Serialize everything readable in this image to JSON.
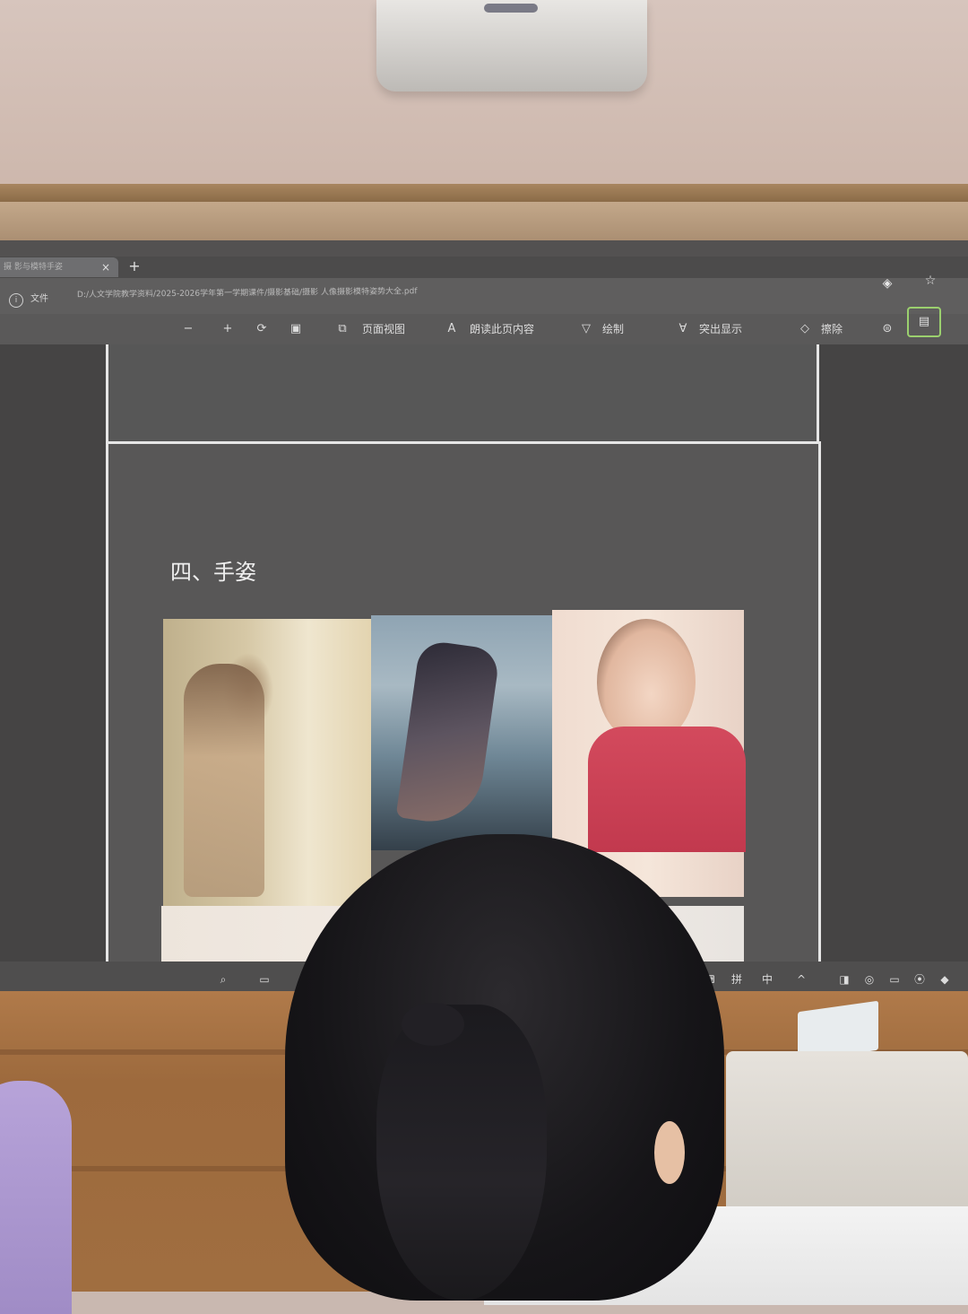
{
  "browser": {
    "tab_label": "摄 影与模特手姿",
    "tab_close": "×",
    "tab_new": "+",
    "file_label": "文件",
    "url": "D:/人文学院教学资料/2025-2026学年第一学期课件/摄影基础/摄影 人像摄影模特姿势大全.pdf"
  },
  "pdf_toolbar": {
    "zoom_out": "−",
    "zoom_in": "+",
    "page_view": "页面视图",
    "read_aloud": "朗读此页内容",
    "draw": "绘制",
    "highlight": "突出显示",
    "erase": "擦除"
  },
  "pdf_page": {
    "heading": "四、手姿"
  },
  "statusbar": {
    "ime_label": "拼",
    "ime_mode": "中"
  },
  "icons": {
    "info": "info-icon",
    "lock": "lock-icon",
    "star": "star-icon"
  }
}
